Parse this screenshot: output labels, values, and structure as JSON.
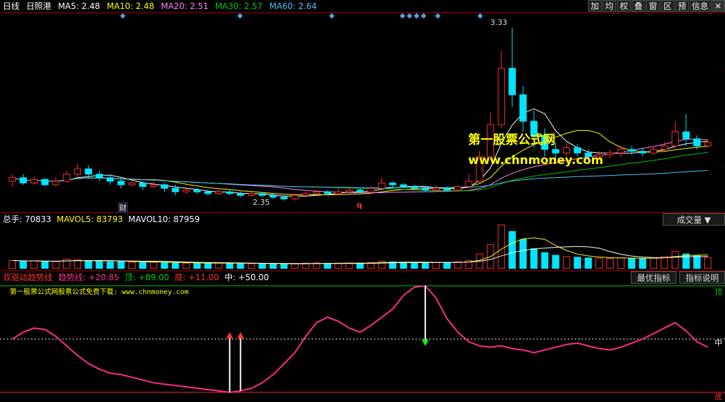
{
  "header": {
    "period": "日线",
    "stock": "日照港",
    "ma5": "MA5: 2.48",
    "ma10": "MA10: 2.48",
    "ma20": "MA20: 2.51",
    "ma30": "MA30: 2.57",
    "ma60": "MA60: 2.64"
  },
  "toolbar": [
    "加",
    "均",
    "权",
    "叠",
    "窗",
    "区",
    "预",
    "信息",
    "✕"
  ],
  "colors": {
    "up": "#ff3030",
    "down": "#00e5ff",
    "ma5": "#ffffff",
    "ma10": "#ffff00",
    "ma20": "#ff80ff",
    "ma30": "#00cc00",
    "ma60": "#4fc3f7",
    "osc": "#ff2d8c"
  },
  "annotations": {
    "high": "3.33",
    "low": "2.35",
    "cai": "财",
    "q": "q"
  },
  "watermark": {
    "line1": "第一股票公式网",
    "line2": "www.chnmoney.com"
  },
  "volume": {
    "zongshou": "总手: 70833",
    "mavol5": "MAVOL5: 83793",
    "mavol10": "MAVOL10: 87959",
    "button": "成交量"
  },
  "indicator": {
    "name": "双驱动趋势线",
    "trend": "趋势线: +20.85",
    "top": "顶: +89.00",
    "bottom": "底: +11.00",
    "mid": "中: +50.00",
    "note": "第一股票公式网股票公式免费下载: www.chnmoney.com",
    "btn_best": "最优指标",
    "btn_help": "指标说明",
    "right_top": "顶",
    "right_mid": "中",
    "right_bottom": "底"
  },
  "chart_data": [
    {
      "type": "candlestick",
      "title": "日照港",
      "ylim": [
        2.35,
        3.33
      ],
      "candles": [
        [
          2.46,
          2.48,
          2.43,
          2.5
        ],
        [
          2.48,
          2.45,
          2.44,
          2.5
        ],
        [
          2.45,
          2.47,
          2.44,
          2.49
        ],
        [
          2.47,
          2.44,
          2.43,
          2.48
        ],
        [
          2.44,
          2.46,
          2.43,
          2.48
        ],
        [
          2.46,
          2.5,
          2.45,
          2.52
        ],
        [
          2.5,
          2.53,
          2.48,
          2.56
        ],
        [
          2.53,
          2.5,
          2.48,
          2.55
        ],
        [
          2.5,
          2.48,
          2.46,
          2.52
        ],
        [
          2.48,
          2.46,
          2.44,
          2.5
        ],
        [
          2.46,
          2.44,
          2.42,
          2.48
        ],
        [
          2.44,
          2.45,
          2.43,
          2.47
        ],
        [
          2.45,
          2.43,
          2.41,
          2.46
        ],
        [
          2.43,
          2.44,
          2.42,
          2.46
        ],
        [
          2.44,
          2.42,
          2.4,
          2.45
        ],
        [
          2.42,
          2.4,
          2.38,
          2.44
        ],
        [
          2.4,
          2.41,
          2.39,
          2.43
        ],
        [
          2.41,
          2.4,
          2.39,
          2.42
        ],
        [
          2.4,
          2.39,
          2.38,
          2.41
        ],
        [
          2.39,
          2.4,
          2.38,
          2.42
        ],
        [
          2.4,
          2.39,
          2.38,
          2.41
        ],
        [
          2.39,
          2.38,
          2.37,
          2.4
        ],
        [
          2.38,
          2.39,
          2.37,
          2.4
        ],
        [
          2.39,
          2.38,
          2.37,
          2.4
        ],
        [
          2.38,
          2.37,
          2.36,
          2.39
        ],
        [
          2.37,
          2.36,
          2.35,
          2.38
        ],
        [
          2.36,
          2.38,
          2.35,
          2.39
        ],
        [
          2.38,
          2.39,
          2.37,
          2.4
        ],
        [
          2.39,
          2.4,
          2.38,
          2.41
        ],
        [
          2.4,
          2.39,
          2.38,
          2.41
        ],
        [
          2.39,
          2.4,
          2.38,
          2.42
        ],
        [
          2.4,
          2.41,
          2.39,
          2.42
        ],
        [
          2.41,
          2.4,
          2.39,
          2.42
        ],
        [
          2.4,
          2.42,
          2.39,
          2.43
        ],
        [
          2.42,
          2.45,
          2.41,
          2.48
        ],
        [
          2.45,
          2.44,
          2.42,
          2.46
        ],
        [
          2.44,
          2.43,
          2.42,
          2.45
        ],
        [
          2.43,
          2.42,
          2.41,
          2.44
        ],
        [
          2.42,
          2.41,
          2.4,
          2.43
        ],
        [
          2.41,
          2.42,
          2.4,
          2.44
        ],
        [
          2.42,
          2.41,
          2.4,
          2.43
        ],
        [
          2.41,
          2.43,
          2.4,
          2.44
        ],
        [
          2.43,
          2.46,
          2.42,
          2.5
        ],
        [
          2.46,
          2.6,
          2.45,
          2.63
        ],
        [
          2.6,
          2.78,
          2.58,
          2.85
        ],
        [
          2.78,
          3.1,
          2.76,
          3.2
        ],
        [
          3.1,
          2.95,
          2.88,
          3.33
        ],
        [
          2.95,
          2.8,
          2.74,
          3.0
        ],
        [
          2.8,
          2.72,
          2.65,
          2.86
        ],
        [
          2.72,
          2.64,
          2.6,
          2.76
        ],
        [
          2.64,
          2.62,
          2.58,
          2.68
        ],
        [
          2.62,
          2.65,
          2.6,
          2.68
        ],
        [
          2.65,
          2.62,
          2.6,
          2.67
        ],
        [
          2.62,
          2.6,
          2.58,
          2.64
        ],
        [
          2.6,
          2.61,
          2.58,
          2.63
        ],
        [
          2.61,
          2.62,
          2.59,
          2.64
        ],
        [
          2.62,
          2.64,
          2.6,
          2.66
        ],
        [
          2.64,
          2.63,
          2.61,
          2.66
        ],
        [
          2.63,
          2.62,
          2.6,
          2.65
        ],
        [
          2.62,
          2.64,
          2.61,
          2.66
        ],
        [
          2.64,
          2.66,
          2.63,
          2.68
        ],
        [
          2.66,
          2.74,
          2.65,
          2.8
        ],
        [
          2.74,
          2.7,
          2.66,
          2.84
        ],
        [
          2.7,
          2.66,
          2.64,
          2.72
        ],
        [
          2.66,
          2.68,
          2.65,
          2.7
        ]
      ]
    },
    {
      "type": "bar",
      "title": "成交量",
      "values": [
        60,
        55,
        58,
        50,
        52,
        70,
        65,
        60,
        55,
        50,
        52,
        48,
        50,
        46,
        44,
        42,
        40,
        38,
        40,
        42,
        40,
        38,
        36,
        35,
        34,
        33,
        36,
        40,
        42,
        38,
        40,
        42,
        40,
        45,
        55,
        50,
        48,
        44,
        42,
        45,
        46,
        50,
        60,
        110,
        180,
        330,
        280,
        220,
        150,
        120,
        100,
        90,
        85,
        80,
        78,
        76,
        80,
        78,
        75,
        80,
        90,
        130,
        110,
        95,
        85
      ]
    },
    {
      "type": "line",
      "title": "双驱动趋势线",
      "ylim": [
        11,
        89
      ],
      "series": [
        {
          "name": "趋势线",
          "values": [
            50,
            55,
            58,
            57,
            52,
            45,
            38,
            32,
            28,
            25,
            24,
            22,
            20,
            18,
            17,
            16,
            15,
            14,
            13,
            12,
            11,
            12,
            14,
            18,
            24,
            32,
            40,
            52,
            62,
            66,
            63,
            58,
            55,
            60,
            66,
            72,
            82,
            88,
            89,
            80,
            65,
            55,
            48,
            45,
            44,
            45,
            43,
            42,
            40,
            42,
            44,
            46,
            47,
            45,
            43,
            42,
            44,
            47,
            50,
            54,
            58,
            62,
            56,
            48,
            44
          ]
        }
      ]
    }
  ]
}
